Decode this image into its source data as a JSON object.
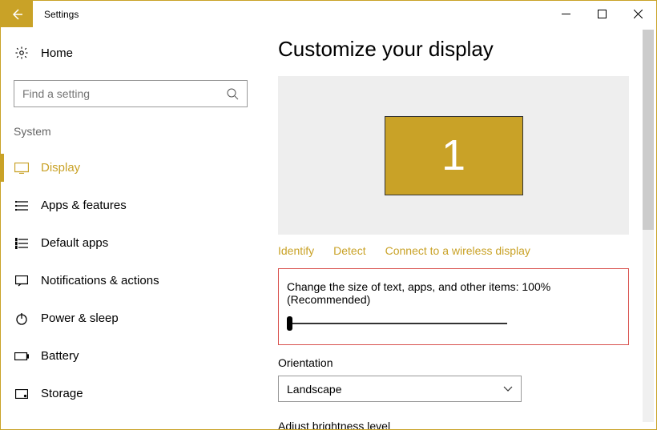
{
  "window": {
    "title": "Settings"
  },
  "sidebar": {
    "home": "Home",
    "search_placeholder": "Find a setting",
    "category": "System",
    "items": [
      {
        "label": "Display",
        "icon": "display-icon",
        "active": true
      },
      {
        "label": "Apps & features",
        "icon": "apps-icon"
      },
      {
        "label": "Default apps",
        "icon": "default-apps-icon"
      },
      {
        "label": "Notifications & actions",
        "icon": "notifications-icon"
      },
      {
        "label": "Power & sleep",
        "icon": "power-icon"
      },
      {
        "label": "Battery",
        "icon": "battery-icon"
      },
      {
        "label": "Storage",
        "icon": "storage-icon"
      }
    ]
  },
  "main": {
    "title": "Customize your display",
    "monitor_number": "1",
    "links": {
      "identify": "Identify",
      "detect": "Detect",
      "connect": "Connect to a wireless display"
    },
    "scale_label": "Change the size of text, apps, and other items: 100% (Recommended)",
    "orientation_label": "Orientation",
    "orientation_value": "Landscape",
    "brightness_label": "Adjust brightness level"
  }
}
